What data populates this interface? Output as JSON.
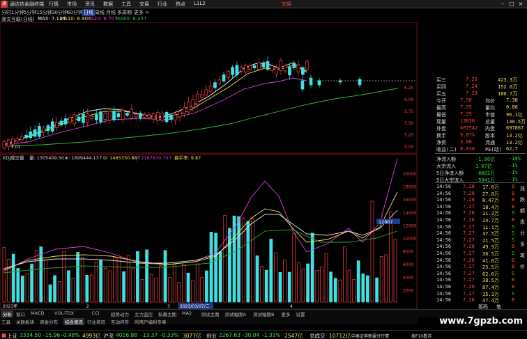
{
  "app": {
    "title": "通达信金融终端",
    "trade_button": "交易",
    "menu": [
      "行情",
      "市场",
      "资讯",
      "数据",
      "工具",
      "交易",
      "行业",
      "热点",
      "L1L2"
    ]
  },
  "periods": [
    "分时",
    "1分钟",
    "5分钟",
    "15分钟",
    "30分钟",
    "60分钟",
    "日线",
    "周线",
    "月线",
    "多周期",
    "更多 >"
  ],
  "active_period": "日线",
  "main_chart": {
    "stock_title": "浙文互联(日线)",
    "ma5": "MA5: 7.12↑",
    "ma10": "MA10: 6.90↑",
    "ma20": "MA20: 6.70↑",
    "ma60": "MA60: 6.35↑",
    "low_marker": "5.01",
    "price_ticks": [
      "6.25",
      "6.00",
      "5.75",
      "5.50",
      "5.25",
      "5.00"
    ],
    "colors": {
      "up": "#ff4040",
      "down": "#40e0e0",
      "ma5": "#ffffff",
      "ma10": "#f0e060",
      "ma20": "#e040e0",
      "ma60": "#30c030"
    }
  },
  "sub_chart": {
    "indicator_title": "KDJ成交量",
    "label_vol": "量: 1305409.50↓",
    "label_k": "K: 1699444.13↑",
    "label_d": "D: 1465330.88↑",
    "label_j": "J: 2167670.75↑",
    "label_turnover": "换手率: 9.87",
    "vol_ticks": [
      "20000",
      "18000",
      "16000",
      "14000",
      "12000",
      "10000",
      "8000",
      "6000",
      "4000",
      "2000"
    ],
    "last_vol_tag": "12907",
    "date_axis": [
      "2023年",
      "2023/03/07/二"
    ],
    "axis_marks": [
      "2",
      "3",
      "4"
    ]
  },
  "quote_panel": {
    "ask_rows": [
      {
        "label": "买三",
        "price": "7.25",
        "vol": "423.3万"
      },
      {
        "label": "买四",
        "price": "7.24",
        "vol": "152.0万"
      },
      {
        "label": "买五",
        "price": "7.23",
        "vol": "180.7万"
      }
    ],
    "stats": [
      {
        "l1": "今开",
        "v1": "7.50",
        "l2": "均价",
        "v2": "7.38"
      },
      {
        "l1": "最高",
        "v1": "7.55",
        "l2": "量比",
        "v2": "0.88"
      },
      {
        "l1": "最低",
        "v1": "7.25",
        "l2": "市值",
        "v2": "96.1亿"
      },
      {
        "l1": "现量",
        "v1": "13038",
        "l2": "总量",
        "v2": "130.5万"
      },
      {
        "l1": "外盘",
        "v1": "607542",
        "l2": "内盘",
        "v2": "697867"
      },
      {
        "l1": "换手",
        "v1": "9.87%",
        "l2": "股本",
        "v2": "13.2亿"
      },
      {
        "l1": "净资",
        "v1": "3.08",
        "l2": "流通",
        "v2": "13.2亿"
      },
      {
        "l1": "收益(二)",
        "v1": "0.030",
        "l2": "PE(动)",
        "v2": "62.7"
      }
    ],
    "flow": [
      {
        "label": "净流入额",
        "value": "-1.86亿",
        "pct": "-19%"
      },
      {
        "label": "大宗流入",
        "value": "1.07亿",
        "pct": "-1%"
      },
      {
        "label": "5日净流入额",
        "value": "-6602万",
        "pct": "-1%"
      },
      {
        "label": "5日大宗流入",
        "value": "-5941万",
        "pct": "-1%"
      }
    ],
    "ticks": [
      {
        "time": "14:56",
        "price": "7.28",
        "vol": "17.8万",
        "side": "B"
      },
      {
        "time": "14:56",
        "price": "7.28",
        "vol": "27.8万",
        "side": "B"
      },
      {
        "time": "14:56",
        "price": "7.28",
        "vol": "8.47万",
        "side": "B"
      },
      {
        "time": "14:56",
        "price": "7.27",
        "vol": "18.4万",
        "side": "B"
      },
      {
        "time": "14:56",
        "price": "7.28",
        "vol": "21.2万",
        "side": "S"
      },
      {
        "time": "14:56",
        "price": "7.28",
        "vol": "24.7万",
        "side": "B"
      },
      {
        "time": "14:56",
        "price": "7.27",
        "vol": "11.1万",
        "side": "S"
      },
      {
        "time": "14:56",
        "price": "7.27",
        "vol": "37.5万",
        "side": "S"
      },
      {
        "time": "14:56",
        "price": "7.27",
        "vol": "21.5万",
        "side": "S"
      },
      {
        "time": "14:56",
        "price": "7.28",
        "vol": "49.9万",
        "side": "B"
      },
      {
        "time": "14:56",
        "price": "7.27",
        "vol": "36.5万",
        "side": "S"
      },
      {
        "time": "14:56",
        "price": "7.28",
        "vol": "41.6万",
        "side": "B"
      },
      {
        "time": "14:56",
        "price": "7.27",
        "vol": "25.5万",
        "side": "B"
      },
      {
        "time": "14:56",
        "price": "7.27",
        "vol": "62.0万",
        "side": "S"
      },
      {
        "time": "14:56",
        "price": "7.27",
        "vol": "38.5万",
        "side": "B"
      },
      {
        "time": "14:56",
        "price": "7.28",
        "vol": "87.4万",
        "side": "B"
      },
      {
        "time": "14:56",
        "price": "7.27",
        "vol": "15.3万",
        "side": "S"
      },
      {
        "time": "14:56",
        "price": "7.28",
        "vol": "47.4万",
        "side": "B"
      }
    ],
    "side_labels": [
      "涨",
      "跌",
      "额",
      "盘",
      "分",
      "多",
      "笔",
      "价"
    ],
    "bottom_tabs": [
      "筹码",
      "笔"
    ]
  },
  "tabs_row1": [
    "分析",
    "窗口",
    "MACD",
    "VOL-TDX",
    "CCI",
    "趋势动力",
    "主力监控",
    "私募主图",
    "MA2",
    "测试主图",
    "测试幅图A",
    "测试幅图B",
    "更多",
    "设置"
  ],
  "tabs_row2": [
    "工具",
    "关联板块",
    "资金分布",
    "综合资讯",
    "行业资讯",
    "互动问答",
    "所用户编利专章"
  ],
  "status": {
    "sh_label": "上证",
    "sh_value": "3334.50",
    "sh_change": "-15.96",
    "sh_pct": "-0.48%",
    "sh_amount": "4993亿",
    "hs_label": "沪深",
    "hs_value": "4016.88",
    "hs_change": "-13.37",
    "hs_pct": "-0.33%",
    "hs_amount": "3077亿",
    "cy_label": "创业",
    "cy_value": "2267.63",
    "cy_change": "-30.04",
    "cy_pct": "-1.31%",
    "cy_amount": "2547亿",
    "total_label": "总成交",
    "total_value": "10712亿",
    "broker": "中泰证券新疆分行情",
    "hint": "按F10看详"
  },
  "watermark": "www.7gpzb.com"
}
